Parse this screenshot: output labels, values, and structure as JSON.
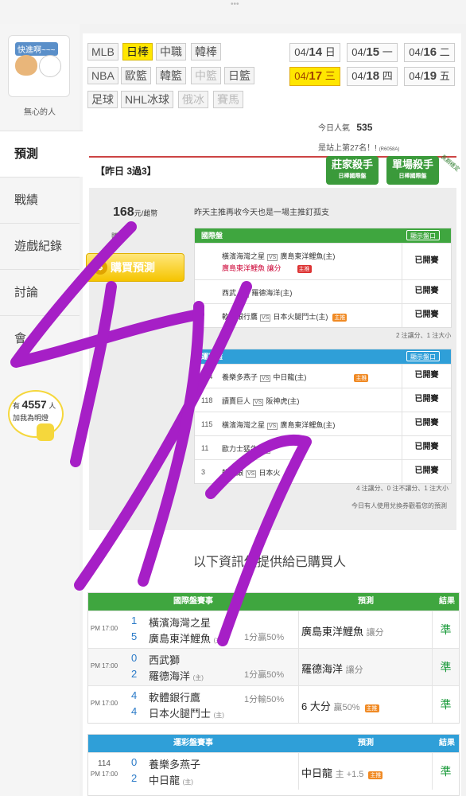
{
  "top": {
    "dots": "•••"
  },
  "user": {
    "avatar_caption": "快進啊~~~",
    "name": "無心的人"
  },
  "nav": [
    "預測",
    "戰績",
    "遊戲紀錄",
    "討論",
    "會"
  ],
  "fans": {
    "prefix": "有",
    "count": "4557",
    "suffix": "人",
    "line2": "加我為明燈"
  },
  "sports": {
    "row1": [
      "MLB",
      "日棒",
      "中職",
      "韓棒"
    ],
    "row2": [
      "NBA",
      "歐籃",
      "韓籃",
      "中籃",
      "日籃"
    ],
    "row3": [
      "足球",
      "NHL冰球",
      "俄冰",
      "賽馬"
    ]
  },
  "dates": [
    {
      "md": "04/",
      "d": "14",
      "w": "日"
    },
    {
      "md": "04/",
      "d": "15",
      "w": "一"
    },
    {
      "md": "04/",
      "d": "16",
      "w": "二"
    },
    {
      "md": "04/",
      "d": "17",
      "w": "三"
    },
    {
      "md": "04/",
      "d": "18",
      "w": "四"
    },
    {
      "md": "04/",
      "d": "19",
      "w": "五"
    }
  ],
  "popularity": {
    "label": "今日人氣",
    "value": "535",
    "rank": "是站上第27名！!",
    "rank_code": "(R6058A)"
  },
  "header": {
    "title": "【昨日 3過3】",
    "badge1": "莊家殺手",
    "badge1_sub": "日棒國際盤",
    "badge2": "單場殺手",
    "badge2_sub": "日棒國際盤",
    "ribbon": "長期穩定"
  },
  "purchase": {
    "price": "168",
    "unit": "元/雌幣",
    "label": "購買",
    "button": "購買預測",
    "button_icon": "$"
  },
  "yesterday_note": "昨天主推再收今天也是一場主推釘孤支",
  "intl": {
    "title": "國際盤",
    "show": "顯示盤口",
    "rows": [
      {
        "code": "",
        "away": "橫濱海灣之星",
        "home": "廣島東洋鯉魚(主)",
        "pick": "廣島東洋鯉魚  讓分",
        "pick_tag": "主推",
        "status": "已開賽"
      },
      {
        "code": "",
        "away": "西武",
        "home": "羅德海洋(主)",
        "pick": "",
        "pick_tag": "",
        "status": "已開賽"
      },
      {
        "code": "",
        "away": "軟體銀行鷹",
        "home": "日本火腿鬥士(主)",
        "pick": "",
        "pick_tag": "主推",
        "status": "已開賽"
      }
    ],
    "summary": "2 注讓分、1 注大小"
  },
  "lottery": {
    "title": "運彩盤",
    "show": "顯示盤口",
    "rows": [
      {
        "code": "114",
        "away": "養樂多燕子",
        "home": "中日龍(主)",
        "tag": "主推",
        "status": "已開賽"
      },
      {
        "code": "118",
        "away": "讀賣巨人",
        "home": "阪神虎(主)",
        "tag": "",
        "status": "已開賽"
      },
      {
        "code": "115",
        "away": "橫濱海灣之星",
        "home": "廣島東洋鯉魚(主)",
        "tag": "",
        "status": "已開賽"
      },
      {
        "code": "11",
        "away": "歐力士猛牛",
        "home": "",
        "tag": "",
        "status": "已開賽"
      },
      {
        "code": "3",
        "away": "軟體銀",
        "home": "日本火",
        "tag": "",
        "status": "已開賽"
      }
    ],
    "summary": "4 注讓分、0 注不讓分、1 注大小",
    "note": "今日有人使用兌換券觀看您的預測"
  },
  "info_text": "以下資訊僅提供給已購買人",
  "results_intl": {
    "head": [
      "國際盤賽事",
      "預測",
      "結果"
    ],
    "rows": [
      {
        "time": "PM 17:00",
        "s1": "1",
        "t1": "橫濱海灣之星",
        "s2": "5",
        "t2": "廣島東洋鯉魚",
        "home_mark": "(主)",
        "handicap": "1分贏50%",
        "pred": "廣島東洋鯉魚",
        "pred_note": "讓分",
        "pred_tag": "",
        "result": "準"
      },
      {
        "time": "PM 17:00",
        "s1": "0",
        "t1": "西武獅",
        "s2": "2",
        "t2": "羅德海洋",
        "home_mark": "(主)",
        "handicap": "1分贏50%",
        "pred": "羅德海洋",
        "pred_note": "讓分",
        "pred_tag": "",
        "result": "準"
      },
      {
        "time": "PM 17:00",
        "s1": "4",
        "t1": "軟體銀行鷹",
        "s2": "4",
        "t2": "日本火腿鬥士",
        "home_mark": "(主)",
        "handicap": "1分輸50%",
        "pred": "6 大分",
        "pred_note": "贏50%",
        "pred_tag": "主推",
        "result": "準"
      }
    ]
  },
  "results_lottery": {
    "head": [
      "運彩盤賽事",
      "預測",
      "結果"
    ],
    "rows": [
      {
        "num": "114",
        "time": "PM 17:00",
        "s1": "0",
        "t1": "養樂多燕子",
        "s2": "2",
        "t2": "中日龍",
        "home_mark": "(主)",
        "pred": "中日龍",
        "pred_note": "主 +1.5",
        "pred_tag": "主推",
        "result": "準"
      }
    ]
  },
  "colors": {
    "accent_yellow": "#ffe600",
    "green": "#3fa63f",
    "blue": "#2f9fd8",
    "scribble": "#a61fc6"
  }
}
